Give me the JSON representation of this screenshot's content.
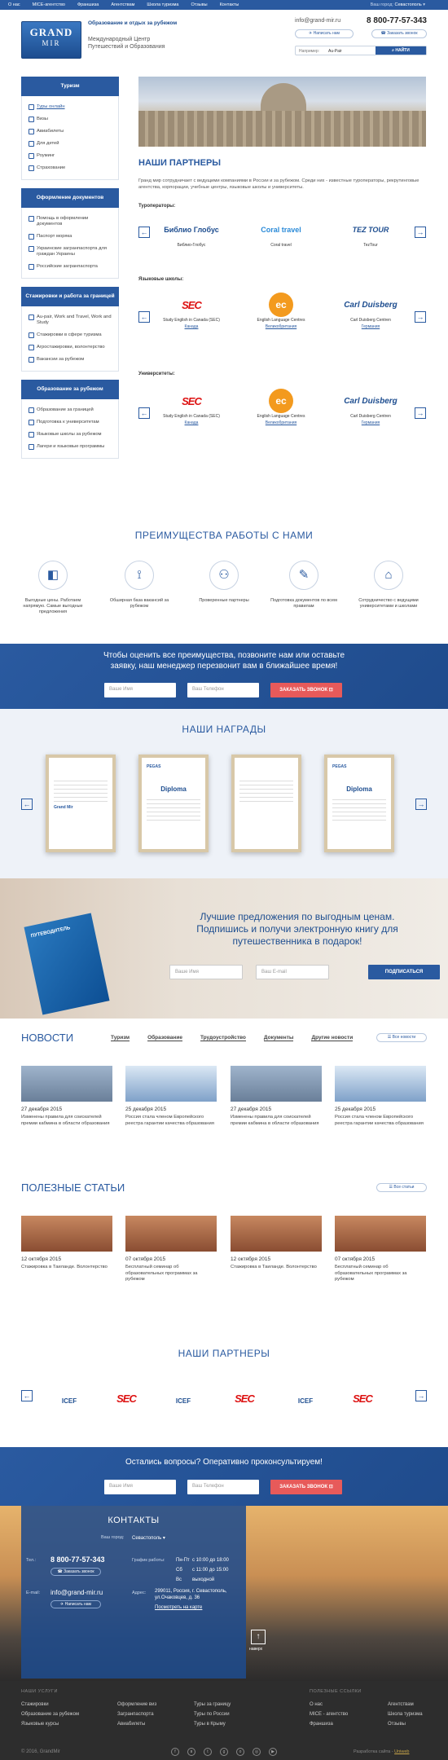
{
  "topbar": {
    "menu": [
      "О нас",
      "MICE-агентство",
      "Франшиза",
      "Агентствам",
      "Школа туризма",
      "Отзывы",
      "Контакты"
    ],
    "city_label": "Ваш город:",
    "city": "Севастополь"
  },
  "header": {
    "logo_top": "GRAND",
    "logo_bottom": "MIR",
    "tagline": "Образование и отдых за рубежом",
    "subtitle1": "Международный Центр",
    "subtitle2": "Путешествий и Образования",
    "email": "info@grand-mir.ru",
    "phone": "8 800-77-57-343",
    "write_btn": "Написать нам",
    "call_btn": "Заказать звонок",
    "search_label": "Например:",
    "search_value": "Au-Pair",
    "search_btn": "НАЙТИ"
  },
  "sidebar": {
    "sections": [
      {
        "title": "Туризм",
        "items": [
          "Туры онлайн",
          "Визы",
          "Авиабилеты",
          "Для детей",
          "Роуминг",
          "Страхование"
        ]
      },
      {
        "title": "Оформление документов",
        "items": [
          "Помощь в оформлении документов",
          "Паспорт моряка",
          "Украинские загранпаспорта для граждан Украины",
          "Российские загранпаспорта"
        ]
      },
      {
        "title": "Стажировки и работа за границей",
        "items": [
          "Au-pair, Work and Travel, Work and Study",
          "Стажировки в сфере туризма",
          "Агростажировки, волонтерство",
          "Вакансии за рубежом"
        ]
      },
      {
        "title": "Образование за рубежом",
        "items": [
          "Образование за границей",
          "Подготовка к университетам",
          "Языковые школы за рубежом",
          "Лагери и языковые программы"
        ]
      }
    ]
  },
  "partners": {
    "title": "НАШИ ПАРТНЕРЫ",
    "desc": "Гранд мир сотрудничает с ведущими компаниями в России и за рубежом. Среди них - известные туроператоры, рекрутинговые агентства, корпорации, учебные центры, языковые школы и университеты.",
    "cat1": "Туроператоры:",
    "tour": [
      {
        "logo": "Библио Глобус",
        "name": "Библио-Глобус"
      },
      {
        "logo": "Coral travel",
        "name": "Coral travel"
      },
      {
        "logo": "TEZ TOUR",
        "name": "TezTour"
      }
    ],
    "cat2": "Языковые школы:",
    "lang": [
      {
        "name": "Study English in Canada (SEC)",
        "country": "Канада"
      },
      {
        "name": "English Language Centres",
        "country": "Великобритания"
      },
      {
        "name": "Carl Duisberg Centren",
        "country": "Германия"
      }
    ],
    "cat3": "Университеты:",
    "univ": [
      {
        "name": "Study English in Canada (SEC)",
        "country": "Канада"
      },
      {
        "name": "English Language Centres",
        "country": "Великобритания"
      },
      {
        "name": "Carl Duisberg Centren",
        "country": "Германия"
      }
    ],
    "logo_sec": "SEC",
    "logo_ec": "ec",
    "logo_cd": "Carl Duisberg"
  },
  "advantages": {
    "title": "ПРЕИМУЩЕСТВА РАБОТЫ С НАМИ",
    "items": [
      "Выгодные цены. Работаем напрямую. Самые выгодные предложения",
      "Обширная база вакансий за рубежом",
      "Проверенные партнеры",
      "Подготовка документов по всем правилам",
      "Сотрудничество с ведущими университетами и школами"
    ]
  },
  "callband": {
    "text1": "Чтобы оценить все преимущества, позвоните нам или оставьте",
    "text2": "заявку, наш менеджер перезвонит вам в ближайшее время!",
    "name_ph": "Ваше Имя",
    "phone_ph": "Ваш Телефон",
    "btn": "ЗАКАЗАТЬ ЗВОНОК"
  },
  "awards": {
    "title": "НАШИ НАГРАДЫ",
    "items": [
      {
        "head": "",
        "title": "",
        "footer": "Grand Mir"
      },
      {
        "head": "PEGAS",
        "title": "Diploma",
        "footer": ""
      },
      {
        "head": "",
        "title": "",
        "footer": ""
      },
      {
        "head": "PEGAS",
        "title": "Diploma",
        "footer": ""
      }
    ]
  },
  "promo": {
    "line1": "Лучшие предложения по выгодным ценам.",
    "line2": "Подпишись и получи электронную книгу для",
    "line3": "путешественника в подарок!",
    "name_ph": "Ваше Имя",
    "email_ph": "Ваш E-mail",
    "btn": "ПОДПИСАТЬСЯ",
    "book": "ПУТЕВОДИТЕЛЬ"
  },
  "news": {
    "title": "НОВОСТИ",
    "tabs": [
      "Туризм",
      "Образование",
      "Трудоустройство",
      "Документы",
      "Другие новости"
    ],
    "all": "Все новости",
    "items": [
      {
        "date": "27 декабря 2015",
        "text": "Изменены правила для соискателей премии кабмина в области образования"
      },
      {
        "date": "25 декабря 2015",
        "text": "Россия стала членом Европейского реестра гарантии качества образования"
      },
      {
        "date": "27 декабря 2015",
        "text": "Изменены правила для соискателей премии кабмина в области образования"
      },
      {
        "date": "25 декабря 2015",
        "text": "Россия стала членом Европейского реестра гарантии качества образования"
      }
    ]
  },
  "articles": {
    "title": "ПОЛЕЗНЫЕ СТАТЬИ",
    "all": "Все статьи",
    "items": [
      {
        "date": "12 октября 2015",
        "text": "Стажировка в Таиланде. Волонтерство"
      },
      {
        "date": "07 октября 2015",
        "text": "Бесплатный семинар об образовательных программах за рубежом"
      },
      {
        "date": "12 октября 2015",
        "text": "Стажировка в Таиланде. Волонтерство"
      },
      {
        "date": "07 октября 2015",
        "text": "Бесплатный семинар об образовательных программах за рубежом"
      }
    ]
  },
  "partners2": {
    "title": "НАШИ ПАРТНЕРЫ",
    "logos": [
      "ICEF",
      "SEC",
      "ICEF",
      "SEC",
      "ICEF",
      "SEC"
    ]
  },
  "consult": {
    "text": "Остались вопросы? Оперативно проконсультируем!",
    "name_ph": "Ваше Имя",
    "phone_ph": "Ваш Телефон",
    "btn": "ЗАКАЗАТЬ ЗВОНОК"
  },
  "contacts": {
    "title": "КОНТАКТЫ",
    "city_label": "Ваш город:",
    "city": "Севастополь",
    "tel_label": "Тел.:",
    "phone": "8 800-77-57-343",
    "call_btn": "Заказать звонок",
    "email_label": "E-mail:",
    "email": "info@grand-mir.ru",
    "write_btn": "Написать нам",
    "sched_label": "График работы:",
    "sched": [
      {
        "d": "Пн-Пт",
        "t": "с 10:00 до 18:00"
      },
      {
        "d": "Сб",
        "t": "с 11:00 до 15:00"
      },
      {
        "d": "Вс",
        "t": "выходной"
      }
    ],
    "addr_label": "Адрес:",
    "addr1": "299011, Россия, г. Севастополь,",
    "addr2": "ул.Очаковцев, д. 36",
    "map_link": "Посмотреть на карте",
    "up": "наверх"
  },
  "footer": {
    "col1": "НАШИ УСЛУГИ",
    "col2": "ПОЛЕЗНЫЕ ССЫЛКИ",
    "services": [
      "Стажировки",
      "Образование за рубежом",
      "Языковые курсы",
      "Оформление виз",
      "Загранпаспорта",
      "Авиабилеты",
      "Туры за границу",
      "Туры по России",
      "Туры в Крыму"
    ],
    "links": [
      "О нас",
      "MICE - агентство",
      "Франшиза",
      "Агентствам",
      "Школа туризма",
      "Отзывы"
    ],
    "copy": "© 2016, GrandMir",
    "dev": "Разработка сайта -",
    "dev_link": "Uniweb"
  },
  "colors": {
    "primary": "#2a5aa0",
    "accent": "#e75a5a",
    "footer": "#2d2d2d"
  }
}
